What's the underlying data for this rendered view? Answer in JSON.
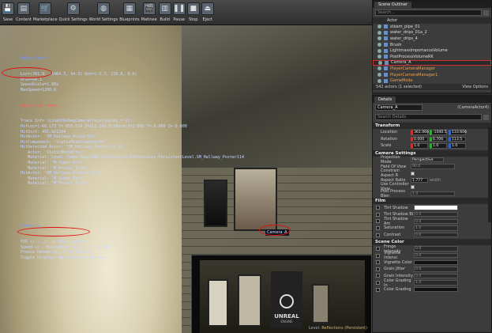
{
  "toolbar": {
    "buttons": [
      {
        "label": "Save",
        "icon": "save-icon",
        "glyph": "💾"
      },
      {
        "label": "Content",
        "icon": "content-icon",
        "glyph": "▤"
      },
      {
        "label": "Marketplace",
        "icon": "marketplace-icon",
        "glyph": "🛒"
      },
      {
        "label": "Quick Settings",
        "icon": "settings-icon",
        "glyph": "⚙"
      },
      {
        "label": "World Settings",
        "icon": "world-icon",
        "glyph": "◍"
      },
      {
        "label": "Blueprints",
        "icon": "blueprint-icon",
        "glyph": "▦"
      },
      {
        "label": "Matinee",
        "icon": "matinee-icon",
        "glyph": "🎬"
      },
      {
        "label": "Build",
        "icon": "build-icon",
        "glyph": "▥"
      },
      {
        "label": "Pause",
        "icon": "pause-icon",
        "glyph": "❚❚"
      },
      {
        "label": "Stop",
        "icon": "stop-icon",
        "glyph": "■"
      },
      {
        "label": "Eject",
        "icon": "eject-icon",
        "glyph": "⏏"
      }
    ]
  },
  "overlay": {
    "debug_title": "Debug Camera",
    "debug_lines": [
      "Loc=(391.8, -1464.3, 94.3) Rot=(-5.7, 116.8, 0.0)",
      "HFOV=94.1",
      "SpeedScale=1.00x",
      "MaxSpeed=1200.0"
    ],
    "frozen": "Rendering frozen...",
    "trace_lines": [
      "Trace Info (LineOfDebugCameraTraceComplex = 1):",
      "HitLoc=(-66.173 Y=-855.574 Z=111.240 HitNorm:X=1.000 Y=-0.000 Z=-0.000",
      "HitDist: 491.921284",
      "HitActor: 'SM_Hallway_Poster114'",
      "HitComponent: 'StaticMeshComponent0'",
      "HitSelected Actor: 'SM_Hallway_Poster114_12'",
      "   Actor: 'StaticMeshActor'",
      "   Material: Level /Game/Maps/UE4_Reflections.Reflections:PersistentLevel.SM_Hallway_Poster114",
      "   Material: 'M_Signs_Dirt'",
      "   Material: 'M_Poster_Trim'",
      "HitActor: 'SM_Hallway_Poster114_12'",
      "   Material: 'M_Signs_Dirt'",
      "   Material: 'M_Poster_Trim'"
    ],
    "controls_title": "Controls",
    "control_lines": [
      "FOV +/-: ,/. or DPad Up/Down",
      "Speed +/-: MouseWheel or +/- or LB/RB",
      "Freeze Rendering: F or YButton",
      "Toggle Display: BackSpace or XButton"
    ]
  },
  "viewport": {
    "camera_tag": "Camera_A",
    "pip_poster_text": "UNREAL",
    "pip_poster_sub": "ENGINE",
    "status_level_label": "Level:",
    "status_level_value": "Reflections (Persistent)"
  },
  "outliner": {
    "tab": "Scene Outliner",
    "search_placeholder": "Search...",
    "column": "Actor",
    "items": [
      {
        "label": "steam_pipe_01",
        "style": "normal"
      },
      {
        "label": "water_drips_01a_2",
        "style": "normal"
      },
      {
        "label": "water_drips_4",
        "style": "normal"
      },
      {
        "label": "Brush",
        "style": "normal"
      },
      {
        "label": "LightmassImportanceVolume",
        "style": "normal"
      },
      {
        "label": "PostProcessVolumeRK",
        "style": "normal"
      },
      {
        "label": "Camera_A",
        "style": "selected"
      },
      {
        "label": "PlayerCameraManager",
        "style": "orange"
      },
      {
        "label": "PlayerCameraManager1",
        "style": "orange"
      },
      {
        "label": "GameMode",
        "style": "orange"
      }
    ],
    "footer_count": "542 actors (1 selected)",
    "view_options": "View Options"
  },
  "details": {
    "tab": "Details",
    "name_value": "Camera_A",
    "instance_label": "(CameraActor4)",
    "search_placeholder": "Search Details",
    "transform_header": "Transform",
    "location_label": "Location",
    "location": [
      "361.066",
      "-1040.5",
      "133.606"
    ],
    "rotation_label": "Rotation",
    "rotation": [
      "0.000",
      "6.706",
      "113.5"
    ],
    "scale_label": "Scale",
    "scale": [
      "1.0",
      "1.0",
      "1.0"
    ],
    "camera_header": "Camera Settings",
    "projection_label": "Projection Mode",
    "projection_value": "Perspective",
    "fov_label": "Field Of View",
    "fov_value": "90.0",
    "constrain_label": "Constrain Aspect R",
    "aspect_label": "Aspect Ratio",
    "aspect_value": "1.777",
    "aspect_suffix": "width",
    "controller_label": "Use Controller View",
    "pp_label": "Post Process Blen",
    "pp_value": "1.0",
    "film_header": "Film",
    "film_rows": [
      {
        "label": "Tint Shadow",
        "value": ""
      },
      {
        "label": "Tint Shadow Bl",
        "value": "0.0"
      },
      {
        "label": "Tint Shadow Am",
        "value": "0.0"
      },
      {
        "label": "Saturation",
        "value": "1.0"
      },
      {
        "label": "Contrast",
        "value": "0.0"
      }
    ],
    "scene_color_header": "Scene Color",
    "scene_rows": [
      {
        "label": "Fringe Intensity",
        "value": "0.0"
      },
      {
        "label": "Vignette Intensi",
        "value": "0.0"
      },
      {
        "label": "Vignette Color",
        "value": ""
      },
      {
        "label": "Grain Jitter",
        "value": "0.0"
      },
      {
        "label": "Grain Intensity",
        "value": "0.0"
      },
      {
        "label": "Color Grading In",
        "value": "1.0"
      },
      {
        "label": "Color Grading",
        "value": ""
      }
    ],
    "none_label": "None"
  }
}
